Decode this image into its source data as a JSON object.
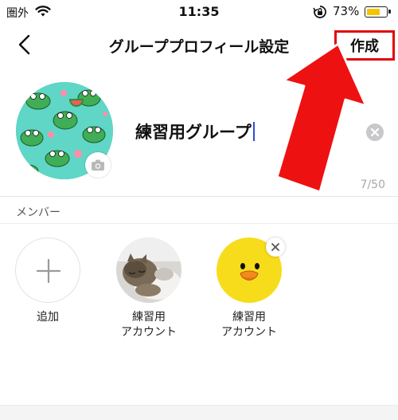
{
  "status_bar": {
    "carrier": "圏外",
    "time": "11:35",
    "battery_percent": "73%",
    "battery_level": 0.73
  },
  "header": {
    "title": "グループプロフィール設定",
    "create_label": "作成",
    "highlight_color": "#e3050e"
  },
  "profile": {
    "group_name": "練習用グループ",
    "char_counter": "7/50"
  },
  "members_section": {
    "label": "メンバー",
    "items": [
      {
        "label": "追加"
      },
      {
        "label_line1": "練習用",
        "label_line2": "アカウント"
      },
      {
        "label_line1": "練習用",
        "label_line2": "アカウント"
      }
    ]
  },
  "colors": {
    "accent_caret": "#2d4fd0",
    "annotation_red": "#e3050e",
    "avatar_yellow": "#f7dc1c",
    "profile_bg": "#5fd6c6"
  }
}
